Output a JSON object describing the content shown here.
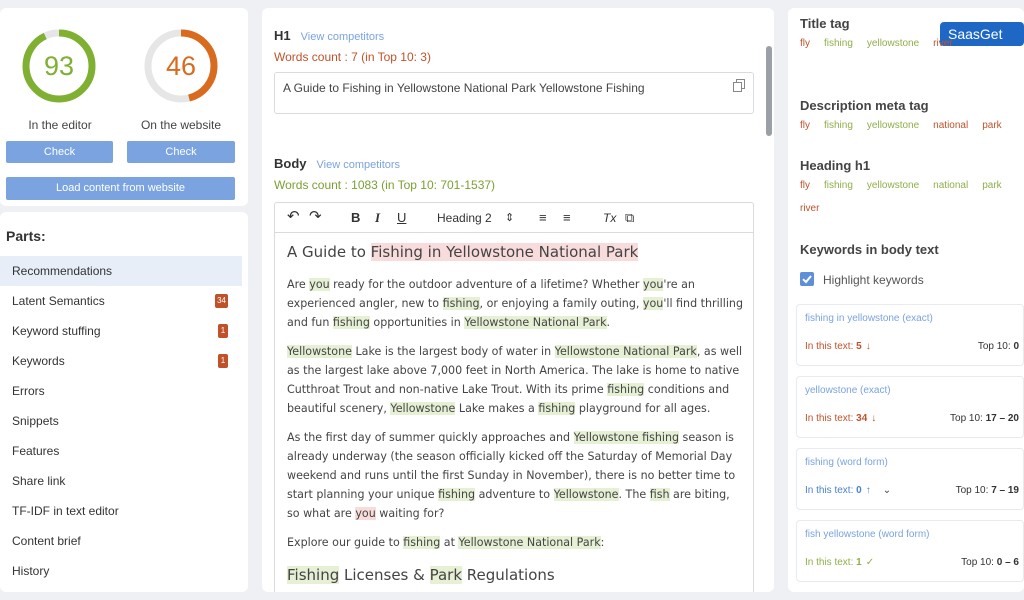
{
  "scores": {
    "editor": {
      "value": "93",
      "label": "In the editor",
      "button": "Check",
      "color": "#7fb032",
      "fraction": 0.93
    },
    "website": {
      "value": "46",
      "label": "On the website",
      "button": "Check",
      "color": "#d96b1f",
      "fraction": 0.46
    },
    "load_button": "Load content from website"
  },
  "parts": {
    "title": "Parts:",
    "items": [
      {
        "label": "Recommendations",
        "badge": ""
      },
      {
        "label": "Latent Semantics",
        "badge": "34"
      },
      {
        "label": "Keyword stuffing",
        "badge": "1"
      },
      {
        "label": "Keywords",
        "badge": "1"
      },
      {
        "label": "Errors",
        "badge": ""
      },
      {
        "label": "Snippets",
        "badge": ""
      },
      {
        "label": "Features",
        "badge": ""
      },
      {
        "label": "Share link",
        "badge": ""
      },
      {
        "label": "TF-IDF in text editor",
        "badge": ""
      },
      {
        "label": "Content brief",
        "badge": ""
      },
      {
        "label": "History",
        "badge": ""
      }
    ]
  },
  "h1": {
    "title": "H1",
    "link": "View competitors",
    "words": "Words count : 7 (in Top 10: 3)",
    "value": "A Guide to Fishing in Yellowstone National Park Yellowstone Fishing"
  },
  "body": {
    "title": "Body",
    "link": "View competitors",
    "words": "Words count : 1083 (in Top 10: 701-1537)",
    "toolbar": {
      "undo": "↶",
      "redo": "↷",
      "bold": "B",
      "italic": "I",
      "underline": "U",
      "heading": "Heading 2",
      "heading_arrow": "⇕",
      "ol": "≡",
      "ul": "≡",
      "clear": "Tx",
      "copy": "⧉"
    }
  },
  "content": {
    "heading_prefix": "A Guide to ",
    "heading_hl": "Fishing in Yellowstone National Park",
    "p1": [
      {
        "t": "Are ",
        "h": ""
      },
      {
        "t": "you",
        "h": "hl"
      },
      {
        "t": " ready for the outdoor adventure of a lifetime? Whether ",
        "h": ""
      },
      {
        "t": "you",
        "h": "hl"
      },
      {
        "t": "'re an experienced angler, new to ",
        "h": ""
      },
      {
        "t": "fishing",
        "h": "hl"
      },
      {
        "t": ", or enjoying a family outing, ",
        "h": ""
      },
      {
        "t": "you",
        "h": "hl"
      },
      {
        "t": "'ll find thrilling and fun ",
        "h": ""
      },
      {
        "t": "fishing",
        "h": "hl"
      },
      {
        "t": " opportunities in ",
        "h": ""
      },
      {
        "t": "Yellowstone National Park",
        "h": "hl"
      },
      {
        "t": ".",
        "h": ""
      }
    ],
    "p2": [
      {
        "t": "Yellowstone",
        "h": "hl"
      },
      {
        "t": " Lake is the largest body of water in ",
        "h": ""
      },
      {
        "t": "Yellowstone National Park",
        "h": "hl"
      },
      {
        "t": ", as well as the largest lake above 7,000 feet in North America. The lake is home to native Cutthroat Trout and non-native Lake Trout. With its prime ",
        "h": ""
      },
      {
        "t": "fishing",
        "h": "hl"
      },
      {
        "t": " conditions and beautiful scenery, ",
        "h": ""
      },
      {
        "t": "Yellowstone",
        "h": "hl"
      },
      {
        "t": " Lake makes a ",
        "h": ""
      },
      {
        "t": "fishing",
        "h": "hl"
      },
      {
        "t": " playground for all ages.",
        "h": ""
      }
    ],
    "p3": [
      {
        "t": "As the first day of summer quickly approaches and ",
        "h": ""
      },
      {
        "t": "Yellowstone fishing",
        "h": "hl"
      },
      {
        "t": " season is already underway (the season officially kicked off the Saturday of Memorial Day weekend and runs until the first Sunday in November), there is no better time to start planning your unique ",
        "h": ""
      },
      {
        "t": "fishing",
        "h": "hl"
      },
      {
        "t": " adventure to ",
        "h": ""
      },
      {
        "t": "Yellowstone",
        "h": "hl"
      },
      {
        "t": ". The ",
        "h": ""
      },
      {
        "t": "fish",
        "h": "hl"
      },
      {
        "t": " are biting, so what are ",
        "h": ""
      },
      {
        "t": "you",
        "h": "hp"
      },
      {
        "t": " waiting for?",
        "h": ""
      }
    ],
    "p4": [
      {
        "t": "Explore our guide to ",
        "h": ""
      },
      {
        "t": "fishing",
        "h": "hl"
      },
      {
        "t": " at ",
        "h": ""
      },
      {
        "t": "Yellowstone National Park",
        "h": "hl"
      },
      {
        "t": ":",
        "h": ""
      }
    ],
    "h3": [
      {
        "t": "Fishing",
        "h": "hl"
      },
      {
        "t": " Licenses & ",
        "h": ""
      },
      {
        "t": "Park",
        "h": "hl"
      },
      {
        "t": " Regulations",
        "h": ""
      }
    ]
  },
  "right": {
    "logo": "SaasGet",
    "title_tag": {
      "label": "Title tag",
      "chips": [
        {
          "t": "fly",
          "c": "or"
        },
        {
          "t": "fishing",
          "c": "gr"
        },
        {
          "t": "yellowstone",
          "c": "gr"
        },
        {
          "t": "river",
          "c": "or"
        }
      ]
    },
    "meta_tag": {
      "label": "Description meta tag",
      "chips": [
        {
          "t": "fly",
          "c": "or"
        },
        {
          "t": "fishing",
          "c": "gr"
        },
        {
          "t": "yellowstone",
          "c": "gr"
        },
        {
          "t": "national",
          "c": "or"
        },
        {
          "t": "park",
          "c": "or"
        }
      ]
    },
    "heading_h1": {
      "label": "Heading h1",
      "chips": [
        {
          "t": "fly",
          "c": "or"
        },
        {
          "t": "fishing",
          "c": "gr"
        },
        {
          "t": "yellowstone",
          "c": "gr"
        },
        {
          "t": "national",
          "c": "gr"
        },
        {
          "t": "park",
          "c": "gr"
        },
        {
          "t": "river",
          "c": "or"
        }
      ]
    },
    "keywords_title": "Keywords in body text",
    "highlight": "Highlight keywords",
    "cards": [
      {
        "name": "fishing in yellowstone (exact)",
        "text_label": "In this text: ",
        "count": "5",
        "arrow": "↓",
        "color": "#c0522a",
        "top_label": "Top 10: ",
        "top": "0"
      },
      {
        "name": "yellowstone (exact)",
        "text_label": "In this text: ",
        "count": "34",
        "arrow": "↓",
        "color": "#c0522a",
        "top_label": "Top 10: ",
        "top": "17 – 20"
      },
      {
        "name": "fishing (word form)",
        "text_label": "In this text: ",
        "count": "0",
        "arrow": "↑",
        "color": "#4a7fd1",
        "top_label": "Top 10: ",
        "top": "7 – 19"
      },
      {
        "name": "fish yellowstone (word form)",
        "text_label": "In this text: ",
        "count": "1",
        "arrow": "✓",
        "color": "#8fae4a",
        "top_label": "Top 10: ",
        "top": "0 – 6"
      }
    ]
  }
}
